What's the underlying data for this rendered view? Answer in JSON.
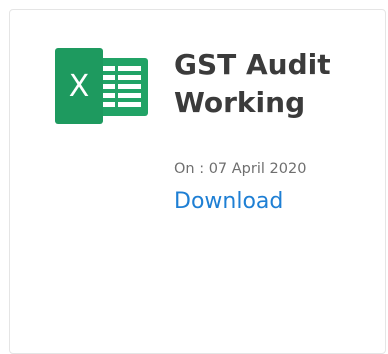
{
  "card": {
    "icon": "excel-file-icon",
    "icon_letter": "X",
    "title": "GST Audit Working",
    "date": "On : 07 April 2020",
    "download_label": "Download"
  },
  "colors": {
    "excel_green": "#21a366",
    "excel_dark_green": "#107c41",
    "link_blue": "#1e7fd4",
    "title_text": "#3b3b3b",
    "meta_text": "#6f6f6f"
  }
}
